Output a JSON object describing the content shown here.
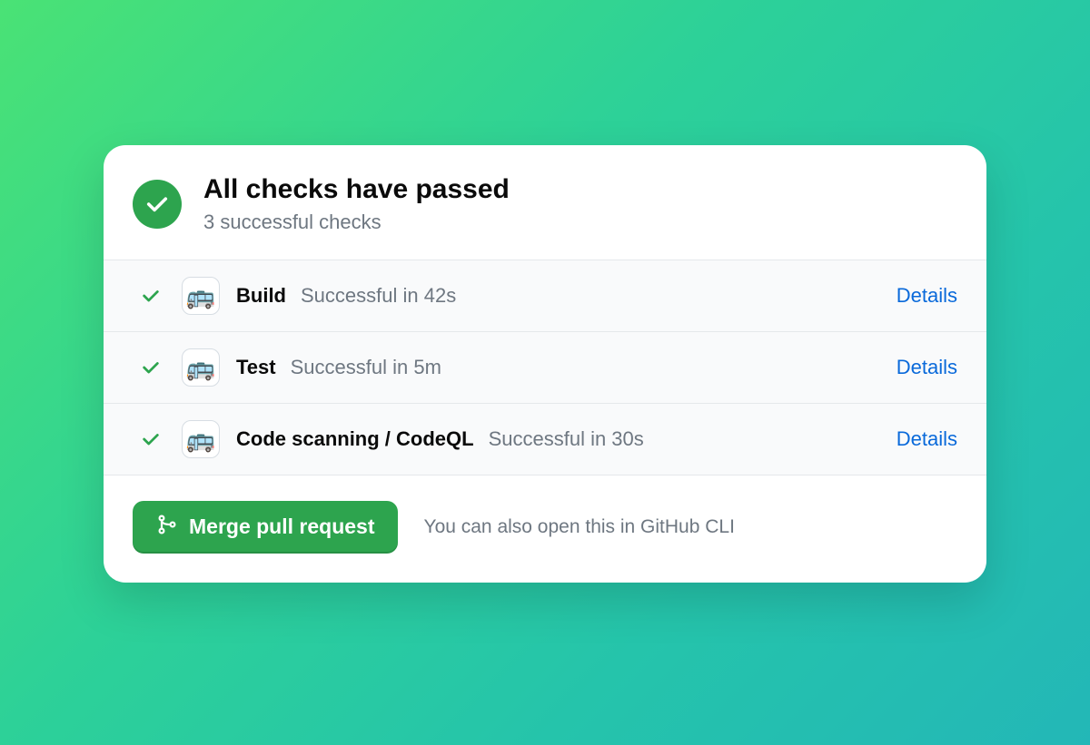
{
  "header": {
    "title": "All checks have passed",
    "subtitle": "3 successful checks"
  },
  "checks": [
    {
      "name": "Build",
      "status": "Successful in 42s",
      "details_label": "Details"
    },
    {
      "name": "Test",
      "status": "Successful in 5m",
      "details_label": "Details"
    },
    {
      "name": "Code scanning / CodeQL",
      "status": "Successful in 30s",
      "details_label": "Details"
    }
  ],
  "footer": {
    "merge_label": "Merge pull request",
    "cli_hint": "You can also open this in GitHub CLI"
  },
  "colors": {
    "success": "#2da44e",
    "link": "#0969da",
    "muted": "#6e7781"
  }
}
